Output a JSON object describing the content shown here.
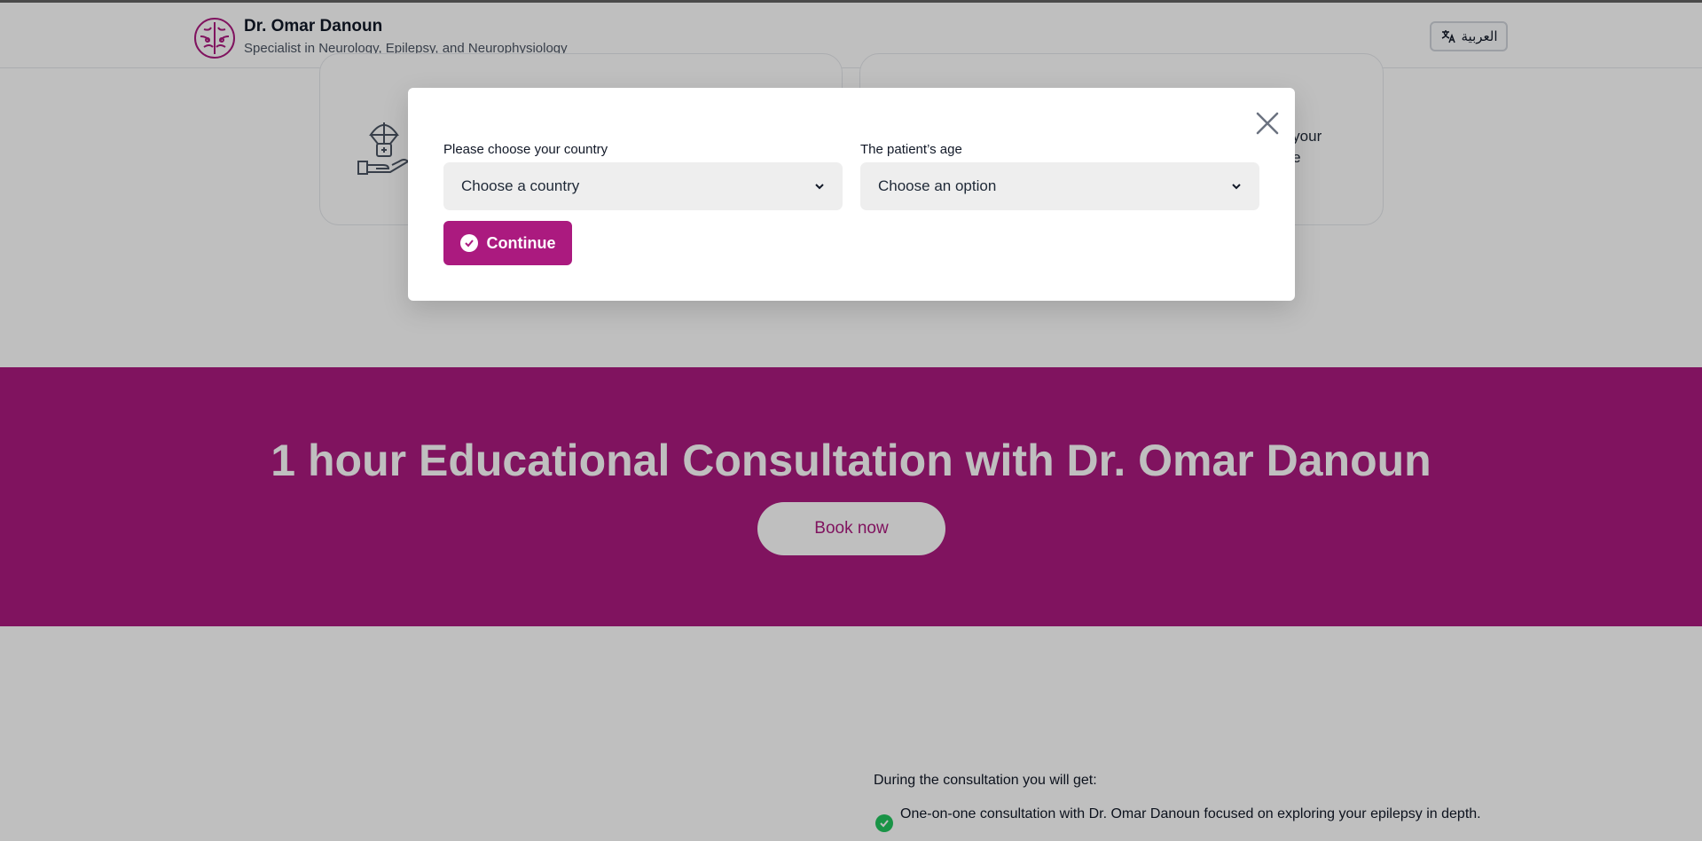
{
  "header": {
    "name": "Dr. Omar Danoun",
    "subtitle": "Specialist in Neurology, Epilepsy, and Neurophysiology",
    "language_button": "العربية",
    "logo_icon": "brain-icon",
    "language_icon": "translate-icon"
  },
  "cards": {
    "right_card_text_line1": "e your",
    "right_card_text_line2": "me",
    "left_card_icon": "hand-parachute-icon"
  },
  "modal": {
    "country_label": "Please choose your country",
    "country_placeholder": "Choose a country",
    "age_label": "The patient’s age",
    "age_placeholder": "Choose an option",
    "continue_label": "Continue",
    "close_icon": "close-icon"
  },
  "promo": {
    "title": "1 hour Educational Consultation with Dr. Omar Danoun",
    "button": "Book now"
  },
  "consultation": {
    "heading": "During the consultation you will get:",
    "benefits": [
      "One-on-one consultation with Dr. Omar Danoun focused on exploring your epilepsy in depth."
    ]
  },
  "colors": {
    "brand": "#ab1a7f",
    "overlay": "rgba(0,0,0,0.25)",
    "check": "#22c55e"
  }
}
